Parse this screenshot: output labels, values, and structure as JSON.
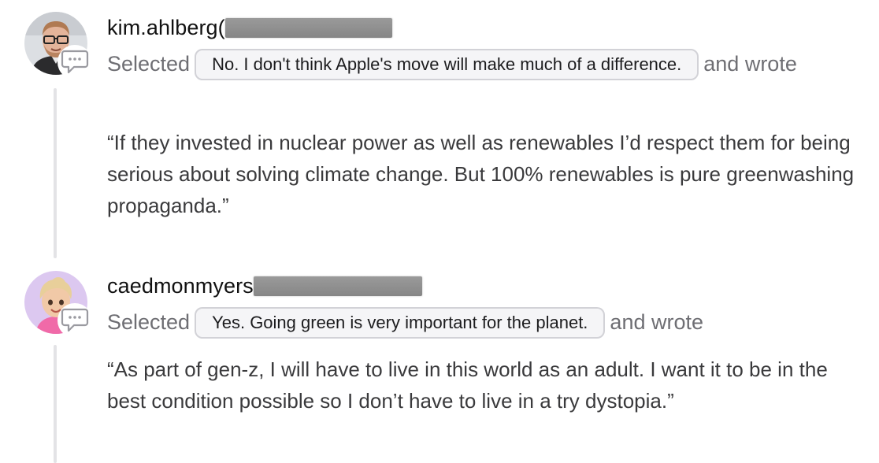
{
  "responses": [
    {
      "username": "kim.ahlberg(",
      "selected_label": "Selected",
      "selected_option": "No. I don't think Apple's move will make much of a difference.",
      "connector": "and wrote",
      "quote": "“If they invested in nuclear power as well as renewables I’d respect them for being serious about solving climate change. But 100% renewables is pure greenwashing propaganda.”",
      "avatar_icon": "user-photo-man-glasses"
    },
    {
      "username": "caedmonmyers",
      "selected_label": "Selected",
      "selected_option": "Yes. Going green is very important for the planet.",
      "connector": "and wrote",
      "quote": "“As part of gen-z, I will have to live in this world as an adult. I want it to be in the best condition possible so I don’t have to live in a try dystopia.”",
      "avatar_icon": "memoji-avatar"
    }
  ],
  "colors": {
    "muted_text": "#6e6e73",
    "pill_border": "#d2d2d7",
    "thread_line": "#e3e3e6"
  }
}
